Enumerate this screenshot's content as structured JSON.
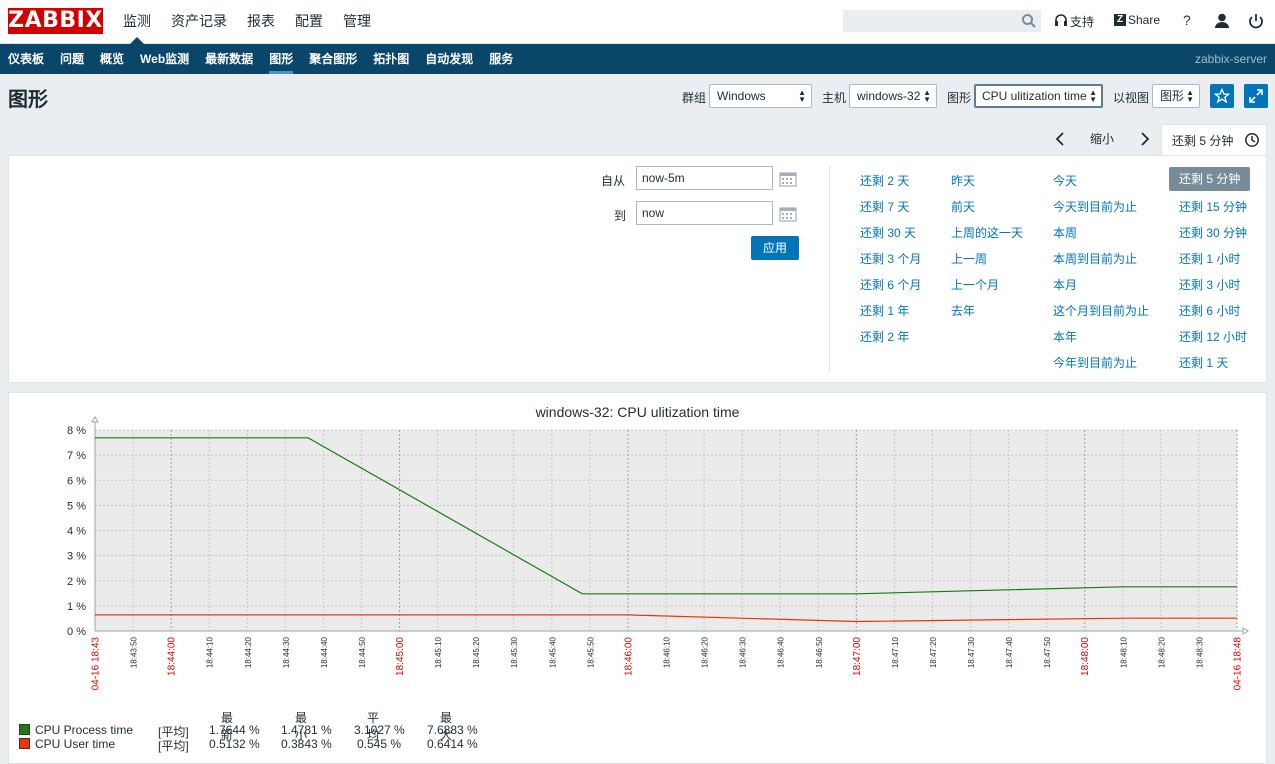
{
  "header": {
    "logo": "ZABBIX",
    "menu": [
      "监测",
      "资产记录",
      "报表",
      "配置",
      "管理"
    ],
    "search_placeholder": "",
    "support_label": "支持",
    "share_label": "Share",
    "help_label": "?",
    "share_z": "Z"
  },
  "subnav": {
    "items": [
      "仪表板",
      "问题",
      "概览",
      "Web监测",
      "最新数据",
      "图形",
      "聚合图形",
      "拓扑图",
      "自动发现",
      "服务"
    ],
    "server": "zabbix-server"
  },
  "page": {
    "title": "图形",
    "filters": {
      "group_label": "群组",
      "group_value": "Windows",
      "host_label": "主机",
      "host_value": "windows-32",
      "graph_label": "图形",
      "graph_value": "CPU ulitization time",
      "view_label": "以视图",
      "view_value": "图形"
    }
  },
  "time": {
    "zoom_out": "缩小",
    "active_tab": "还剩 5 分钟",
    "from_label": "自从",
    "from_value": "now-5m",
    "to_label": "到",
    "to_value": "now",
    "apply": "应用",
    "quick": [
      [
        "还剩 2 天",
        "还剩 7 天",
        "还剩 30 天",
        "还剩 3 个月",
        "还剩 6 个月",
        "还剩 1 年",
        "还剩 2 年"
      ],
      [
        "昨天",
        "前天",
        "上周的这一天",
        "上一周",
        "上一个月",
        "去年"
      ],
      [
        "今天",
        "今天到目前为止",
        "本周",
        "本周到目前为止",
        "本月",
        "这个月到目前为止",
        "本年",
        "今年到目前为止"
      ],
      [
        "还剩 5 分钟",
        "还剩 15 分钟",
        "还剩 30 分钟",
        "还剩 1 小时",
        "还剩 3 小时",
        "还剩 6 小时",
        "还剩 12 小时",
        "还剩 1 天"
      ]
    ],
    "selected_quick": "还剩 5 分钟"
  },
  "chart_data": {
    "type": "line",
    "title": "windows-32: CPU ulitization time",
    "ylim": [
      0,
      8
    ],
    "y_ticks": [
      "0 %",
      "1 %",
      "2 %",
      "3 %",
      "4 %",
      "5 %",
      "6 %",
      "7 %",
      "8 %"
    ],
    "x_range": [
      "18:43:00",
      "18:48:00"
    ],
    "x_ticks": [
      {
        "label": "04-16 18:43",
        "sec": 0,
        "red": true
      },
      {
        "label": "18:43:50",
        "sec": 10
      },
      {
        "label": "18:44:00",
        "sec": 20,
        "red": true
      },
      {
        "label": "18:44:10",
        "sec": 30
      },
      {
        "label": "18:44:20",
        "sec": 40
      },
      {
        "label": "18:44:30",
        "sec": 50
      },
      {
        "label": "18:44:40",
        "sec": 60
      },
      {
        "label": "18:44:50",
        "sec": 70
      },
      {
        "label": "18:45:00",
        "sec": 80,
        "red": true
      },
      {
        "label": "18:45:10",
        "sec": 90
      },
      {
        "label": "18:45:20",
        "sec": 100
      },
      {
        "label": "18:45:30",
        "sec": 110
      },
      {
        "label": "18:45:40",
        "sec": 120
      },
      {
        "label": "18:45:50",
        "sec": 130
      },
      {
        "label": "18:46:00",
        "sec": 140,
        "red": true
      },
      {
        "label": "18:46:10",
        "sec": 150
      },
      {
        "label": "18:46:20",
        "sec": 160
      },
      {
        "label": "18:46:30",
        "sec": 170
      },
      {
        "label": "18:46:40",
        "sec": 180
      },
      {
        "label": "18:46:50",
        "sec": 190
      },
      {
        "label": "18:47:00",
        "sec": 200,
        "red": true
      },
      {
        "label": "18:47:10",
        "sec": 210
      },
      {
        "label": "18:47:20",
        "sec": 220
      },
      {
        "label": "18:47:30",
        "sec": 230
      },
      {
        "label": "18:47:40",
        "sec": 240
      },
      {
        "label": "18:47:50",
        "sec": 250
      },
      {
        "label": "18:48:00",
        "sec": 260,
        "red": true
      },
      {
        "label": "18:48:10",
        "sec": 270
      },
      {
        "label": "18:48:20",
        "sec": 280
      },
      {
        "label": "18:48:30",
        "sec": 290
      },
      {
        "label": "04-16 18:48",
        "sec": 300,
        "red": true
      }
    ],
    "series": [
      {
        "name": "CPU Process time",
        "color": "#1a7c11",
        "points": [
          [
            0,
            7.69
          ],
          [
            56,
            7.69
          ],
          [
            128,
            1.48
          ],
          [
            200,
            1.48
          ],
          [
            270,
            1.76
          ],
          [
            300,
            1.76
          ]
        ]
      },
      {
        "name": "CPU User time",
        "color": "#f63100",
        "points": [
          [
            0,
            0.64
          ],
          [
            140,
            0.64
          ],
          [
            200,
            0.38
          ],
          [
            270,
            0.51
          ],
          [
            300,
            0.51
          ]
        ]
      }
    ],
    "legend": {
      "headers": [
        "最新",
        "最小",
        "平均",
        "最大"
      ],
      "rows": [
        {
          "name": "CPU Process time",
          "func": "[平均]",
          "last": "1.7644 %",
          "min": "1.4781 %",
          "avg": "3.1027 %",
          "max": "7.6883 %",
          "color": "#1a7c11"
        },
        {
          "name": "CPU User time",
          "func": "[平均]",
          "last": "0.5132 %",
          "min": "0.3843 %",
          "avg": "0.545 %",
          "max": "0.6414 %",
          "color": "#f63100"
        }
      ]
    }
  }
}
